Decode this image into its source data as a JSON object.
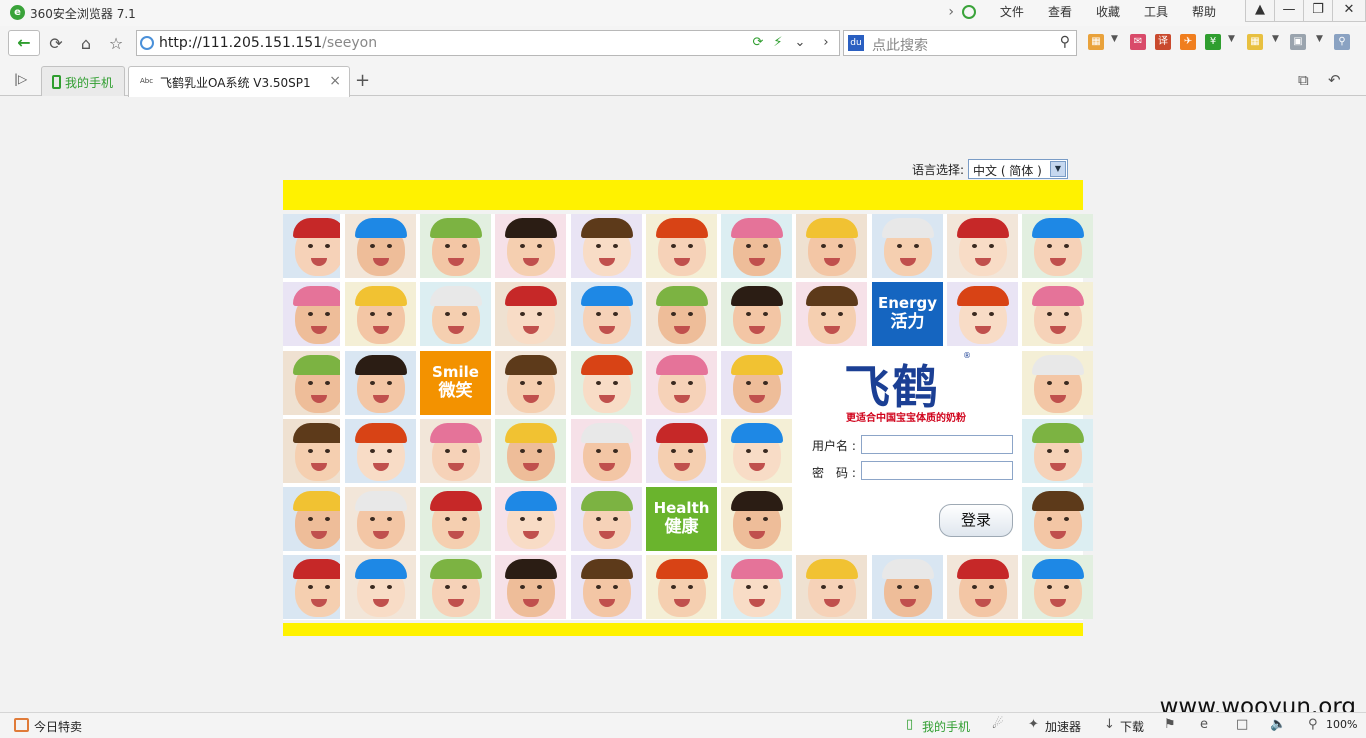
{
  "window": {
    "app_title": "360安全浏览器 7.1",
    "menu": [
      "文件",
      "查看",
      "收藏",
      "工具",
      "帮助"
    ],
    "buttons": [
      "shirt",
      "minimize",
      "restore",
      "close"
    ]
  },
  "nav": {
    "url_host": "http://111.205.151.151",
    "url_path": "/seeyon",
    "search_placeholder": "点此搜索"
  },
  "tabs": {
    "mobile_tab": "我的手机",
    "active_tab": "飞鹤乳业OA系统 V3.50SP1",
    "favicon_text": "Abc"
  },
  "page": {
    "lang_label": "语言选择:",
    "lang_value": "中文 ( 简体 )",
    "brand_name": "飞鹤",
    "brand_slogan": "更适合中国宝宝体质的奶粉",
    "tile_energy_en": "Energy",
    "tile_energy_zh": "活力",
    "tile_smile_en": "Smile",
    "tile_smile_zh": "微笑",
    "tile_health_en": "Health",
    "tile_health_zh": "健康",
    "username_label": "用户名 :",
    "password_label": "密　码 :",
    "username_value": "",
    "password_value": "",
    "login_button": "登录",
    "colors": {
      "band": "#fff200",
      "brand_blue": "#1b3f94",
      "energy_tile": "#1565c0",
      "smile_tile": "#f39200",
      "health_tile": "#6ab42d"
    }
  },
  "watermark": "www.wooyun.org",
  "status": {
    "today_deals": "今日特卖",
    "my_phone": "我的手机",
    "accelerator": "加速器",
    "download": "下载",
    "zoom": "100%"
  }
}
